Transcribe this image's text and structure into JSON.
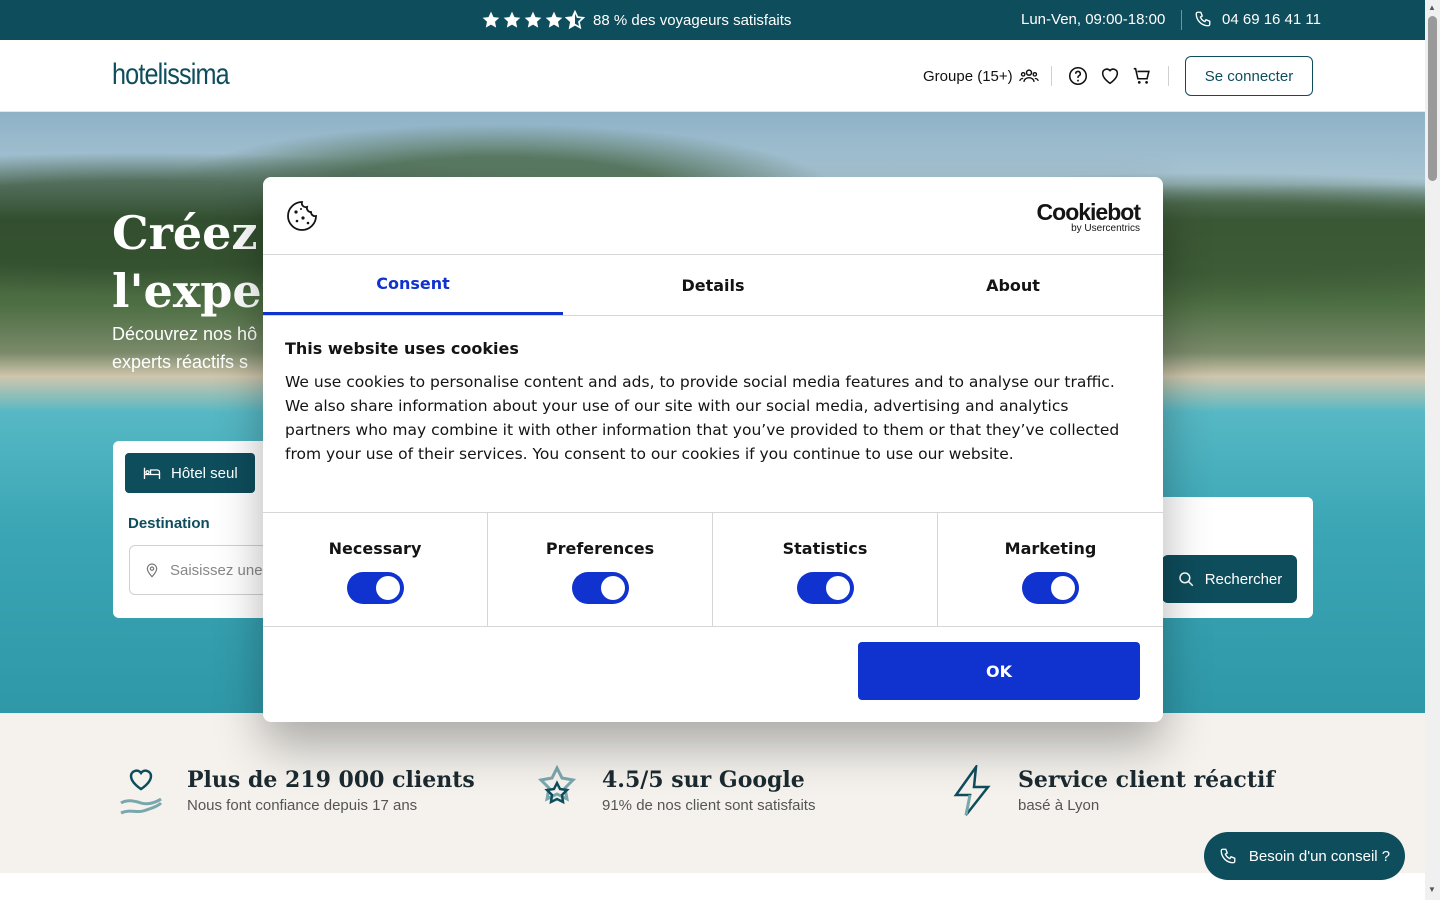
{
  "topbar": {
    "rating_text": "88 % des voyageurs satisfaits",
    "hours": "Lun-Ven, 09:00-18:00",
    "phone": "04 69 16 41 11"
  },
  "header": {
    "logo": "hotelissima",
    "groupe": "Groupe (15+)",
    "login": "Se connecter"
  },
  "hero": {
    "title_line1": "Créez le",
    "title_line2": "l'expert",
    "sub_line1": "Découvrez nos hô",
    "sub_line2": "experts réactifs s"
  },
  "search": {
    "tab_hotel": "Hôtel seul",
    "destination_label": "Destination",
    "destination_placeholder": "Saisissez une",
    "search_button": "Rechercher"
  },
  "features": [
    {
      "title": "Plus de 219 000 clients",
      "sub": "Nous font confiance depuis 17 ans",
      "icon": "heart-hand-icon"
    },
    {
      "title": "4.5/5 sur Google",
      "sub": "91% de nos client sont satisfaits",
      "icon": "star-badge-icon"
    },
    {
      "title": "Service client réactif",
      "sub": "basé à Lyon",
      "icon": "lightning-icon"
    }
  ],
  "advice_button": "Besoin d'un conseil ?",
  "cookie": {
    "brand": "Cookiebot",
    "brand_sub": "by Usercentrics",
    "tabs": [
      "Consent",
      "Details",
      "About"
    ],
    "active_tab": "Consent",
    "heading": "This website uses cookies",
    "body": "We use cookies to personalise content and ads, to provide social media features and to analyse our traffic. We also share information about your use of our site with our social media, advertising and analytics partners who may combine it with other information that you’ve provided to them or that they’ve collected from your use of their services. You consent to our cookies if you continue to use our website.",
    "categories": [
      {
        "label": "Necessary",
        "enabled": true
      },
      {
        "label": "Preferences",
        "enabled": true
      },
      {
        "label": "Statistics",
        "enabled": true
      },
      {
        "label": "Marketing",
        "enabled": true
      }
    ],
    "ok": "OK"
  },
  "colors": {
    "brand_teal": "#0e4d5c",
    "cookie_blue": "#1032cf",
    "features_bg": "#f5f2ed"
  }
}
